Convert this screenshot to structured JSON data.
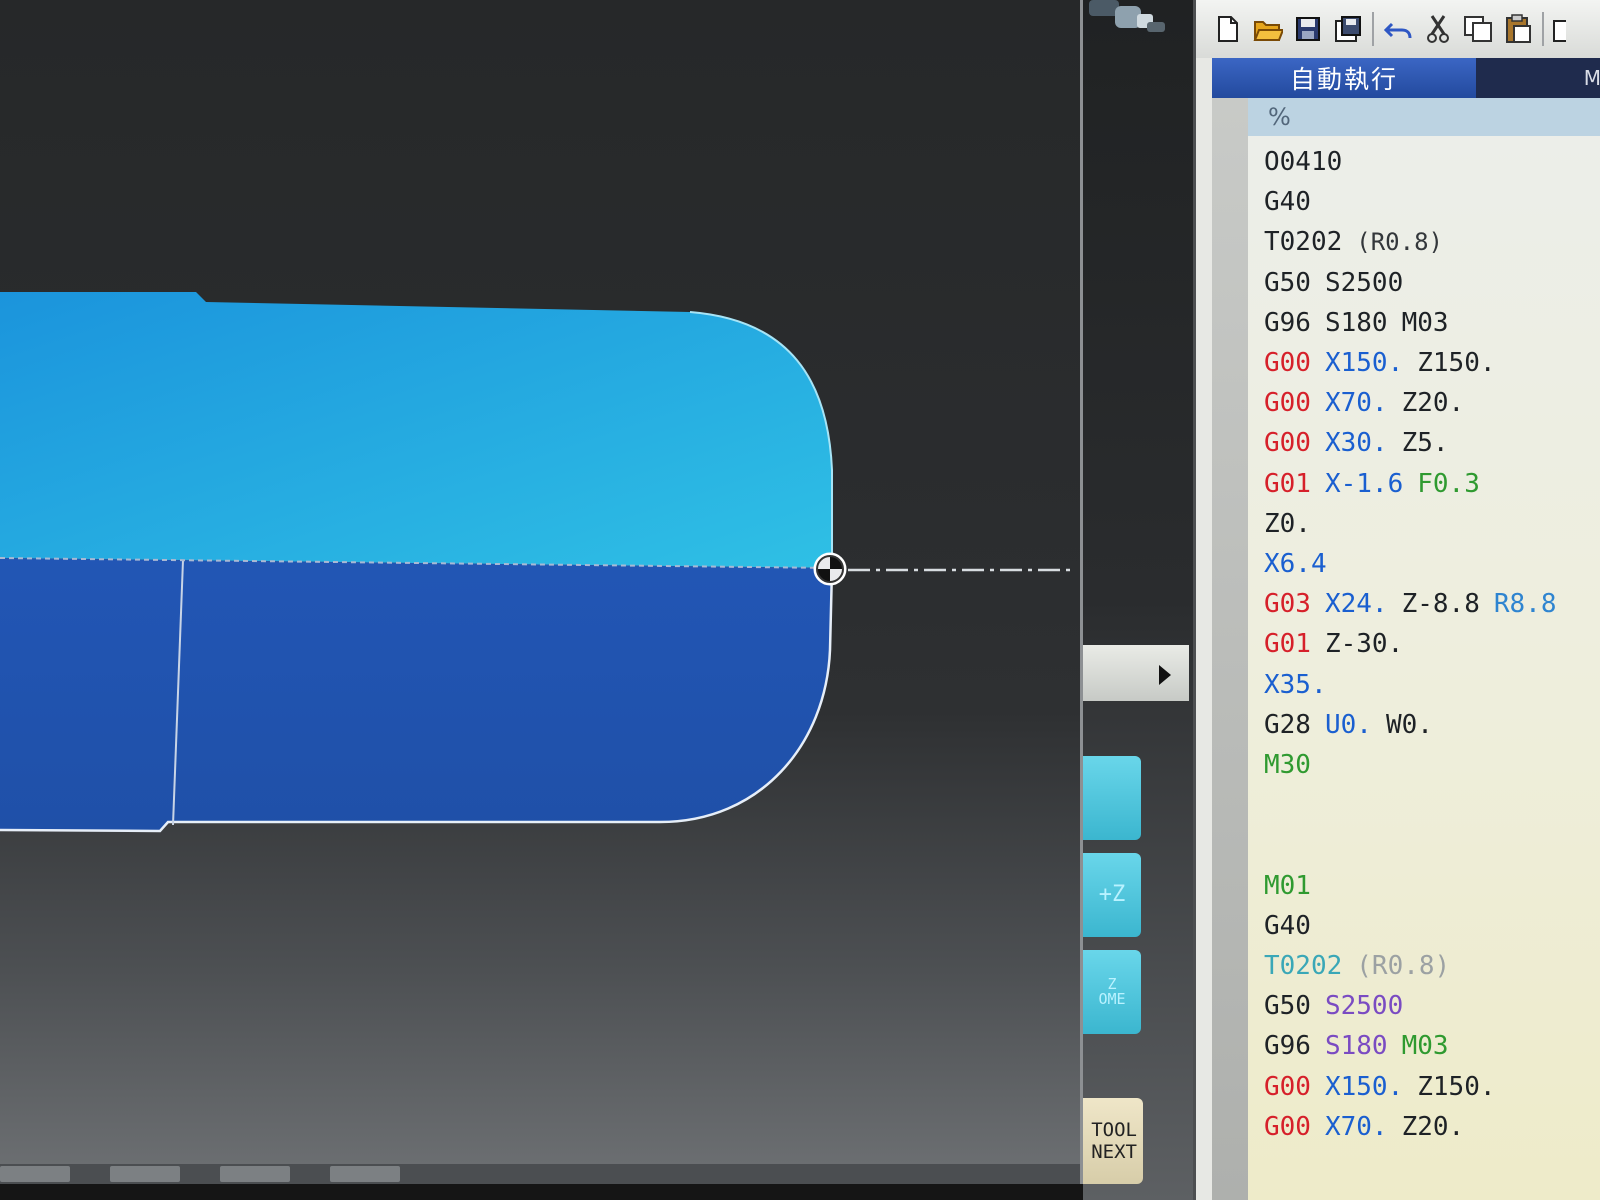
{
  "window": {
    "mode_tab_label": "自動執行",
    "mode_tab_extra": "M"
  },
  "toolbar": {
    "icons": [
      "new-file-icon",
      "open-folder-icon",
      "save-icon",
      "save-as-icon",
      "undo-icon",
      "cut-icon",
      "copy-icon",
      "paste-icon",
      "extra-icon"
    ]
  },
  "viewport": {
    "colors": {
      "workpiece_upper": "#1ea9e3",
      "workpiece_lower": "#2157b8",
      "background": "#27292b"
    }
  },
  "side_buttons": {
    "plus_z_label": "+Z",
    "z_home_top": "Z",
    "z_home_bottom": "OME",
    "tool_next_top": "TOOL",
    "tool_next_bottom": "NEXT"
  },
  "program": {
    "header": "%",
    "lines": [
      [
        {
          "t": "O0410",
          "c": "dark"
        }
      ],
      [
        {
          "t": "G40",
          "c": "dark"
        }
      ],
      [
        {
          "t": "T0202",
          "c": "dark"
        },
        {
          "t": "(R0.8)",
          "c": "paren"
        }
      ],
      [
        {
          "t": "G50",
          "c": "dark"
        },
        {
          "t": "S2500",
          "c": "dark"
        }
      ],
      [
        {
          "t": "G96",
          "c": "dark"
        },
        {
          "t": "S180",
          "c": "dark"
        },
        {
          "t": "M03",
          "c": "dark"
        }
      ],
      [
        {
          "t": "G00",
          "c": "red"
        },
        {
          "t": "X150.",
          "c": "blue"
        },
        {
          "t": "Z150.",
          "c": "dark"
        }
      ],
      [
        {
          "t": "G00",
          "c": "red"
        },
        {
          "t": "X70.",
          "c": "blue"
        },
        {
          "t": "Z20.",
          "c": "dark"
        }
      ],
      [
        {
          "t": "G00",
          "c": "red"
        },
        {
          "t": "X30.",
          "c": "blue"
        },
        {
          "t": "Z5.",
          "c": "dark"
        }
      ],
      [
        {
          "t": "G01",
          "c": "red"
        },
        {
          "t": "X-1.6",
          "c": "blue"
        },
        {
          "t": "F0.3",
          "c": "green"
        }
      ],
      [
        {
          "t": "Z0.",
          "c": "dark"
        }
      ],
      [
        {
          "t": "X6.4",
          "c": "blue"
        }
      ],
      [
        {
          "t": "G03",
          "c": "red"
        },
        {
          "t": "X24.",
          "c": "blue"
        },
        {
          "t": "Z-8.8",
          "c": "dark"
        },
        {
          "t": "R8.8",
          "c": "lblue"
        }
      ],
      [
        {
          "t": "G01",
          "c": "red"
        },
        {
          "t": "Z-30.",
          "c": "dark"
        }
      ],
      [
        {
          "t": "X35.",
          "c": "blue"
        }
      ],
      [
        {
          "t": "G28",
          "c": "dark"
        },
        {
          "t": "U0.",
          "c": "blue"
        },
        {
          "t": "W0.",
          "c": "dark"
        }
      ],
      [
        {
          "t": "M30",
          "c": "green"
        }
      ],
      [],
      [],
      [
        {
          "t": "M01",
          "c": "green"
        }
      ],
      [
        {
          "t": "G40",
          "c": "dark"
        }
      ],
      [
        {
          "t": "T0202",
          "c": "teal"
        },
        {
          "t": "(R0.8)",
          "c": "gray"
        }
      ],
      [
        {
          "t": "G50",
          "c": "dark"
        },
        {
          "t": "S2500",
          "c": "purple"
        }
      ],
      [
        {
          "t": "G96",
          "c": "dark"
        },
        {
          "t": "S180",
          "c": "purple"
        },
        {
          "t": "M03",
          "c": "green"
        }
      ],
      [
        {
          "t": "G00",
          "c": "red"
        },
        {
          "t": "X150.",
          "c": "blue"
        },
        {
          "t": "Z150.",
          "c": "dark"
        }
      ],
      [
        {
          "t": "G00",
          "c": "red"
        },
        {
          "t": "X70.",
          "c": "blue"
        },
        {
          "t": "Z20.",
          "c": "dark"
        }
      ]
    ]
  }
}
